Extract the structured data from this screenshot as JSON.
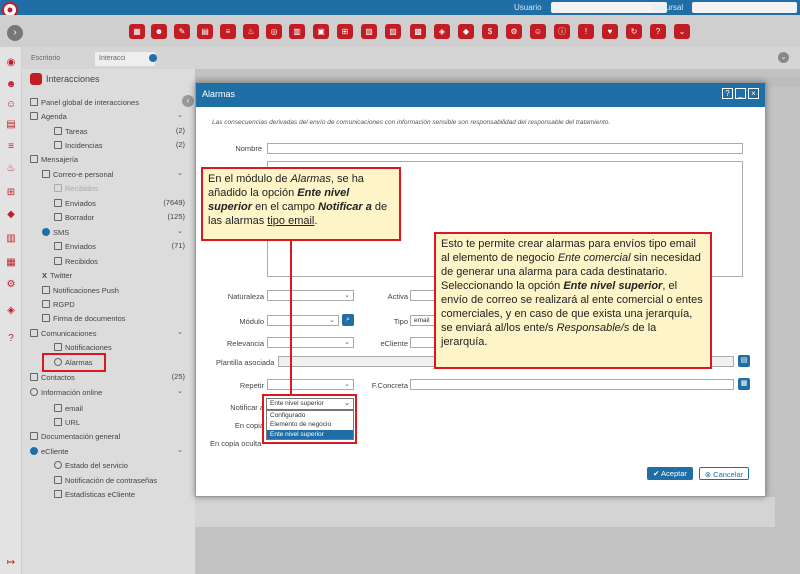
{
  "topbar": {
    "user_label": "Usuario",
    "branch_label": "Sucursal"
  },
  "tabs": {
    "desktop": "Escritorio",
    "interactions": "Interacci"
  },
  "sidebar": {
    "title": "Interacciones",
    "global_panel": "Panel global de interacciones",
    "agenda": "Agenda",
    "tareas": "Tareas",
    "tareas_count": "(2)",
    "incidencias": "Incidencias",
    "incidencias_count": "(2)",
    "mensajeria": "Mensajería",
    "correo": "Correo-e personal",
    "recibidos": "Recibidos",
    "enviados": "Enviados",
    "enviados_count": "(7649)",
    "borrador": "Borrador",
    "borrador_count": "(125)",
    "sms": "SMS",
    "sms_enviados": "Enviados",
    "sms_enviados_count": "(71)",
    "sms_recibidos": "Recibidos",
    "twitter": "Twitter",
    "push": "Notificaciones Push",
    "rgpd": "RGPD",
    "firma": "Firma de documentos",
    "comunicaciones": "Comunicaciones",
    "notificaciones": "Notificaciones",
    "alarmas": "Alarmas",
    "contactos": "Contactos",
    "contactos_count": "(25)",
    "info_online": "Información online",
    "email": "email",
    "url": "URL",
    "documentacion": "Documentación general",
    "ecliente": "eCliente",
    "estado": "Estado del servicio",
    "notif_pass": "Notificación de contraseñas",
    "estadisticas": "Estadísticas eCliente"
  },
  "modal": {
    "title": "Alarmas",
    "notice": "Las consecuencias derivadas del envío de comunicaciones con información sensible son responsabilidad del responsable del tratamiento.",
    "nombre": "Nombre",
    "naturaleza": "Naturaleza",
    "activa": "Activa",
    "modulo": "Módulo",
    "tipo": "Tipo",
    "tipo_value": "email",
    "relevancia": "Relevancia",
    "ecliente": "eCliente",
    "plantilla": "Plantilla asociada",
    "repetir": "Repetir",
    "fconcreta": "F.Concreta",
    "notificar": "Notificar a",
    "encopia": "En copia",
    "encopia_oculta": "En copia oculta",
    "notificar_value": "Ente nivel superior",
    "options": [
      "Configurado",
      "Elemento de negocio",
      "Ente nivel superior"
    ],
    "aceptar": "Aceptar",
    "cancelar": "Cancelar"
  },
  "callout1": {
    "t1": "En el módulo de ",
    "t2": "Alarmas",
    "t3": ", se ha añadido la opción ",
    "t4": "Ente nivel superior",
    "t5": " en el campo ",
    "t6": "Notificar a",
    "t7": " de las alarmas ",
    "t8": "tipo email",
    "t9": "."
  },
  "callout2": {
    "t1": "Esto te permite crear alarmas para envíos tipo email al elemento de negocio ",
    "t2": "Ente comercial",
    "t3": " sin necesidad de generar una alarma para cada destinatario. Seleccionando la opción ",
    "t4": "Ente nivel superior",
    "t5": ", el envío de correo se realizará al ente comercial o entes comerciales, y en caso de que exista una jerarquía, se enviará al/los ente/s ",
    "t6": "Responsable/s",
    "t7": " de la jerarquía."
  },
  "colors": {
    "accent": "#1f6fa6",
    "brand_red": "#c21d25",
    "callout_bg": "#fdf4c8"
  }
}
